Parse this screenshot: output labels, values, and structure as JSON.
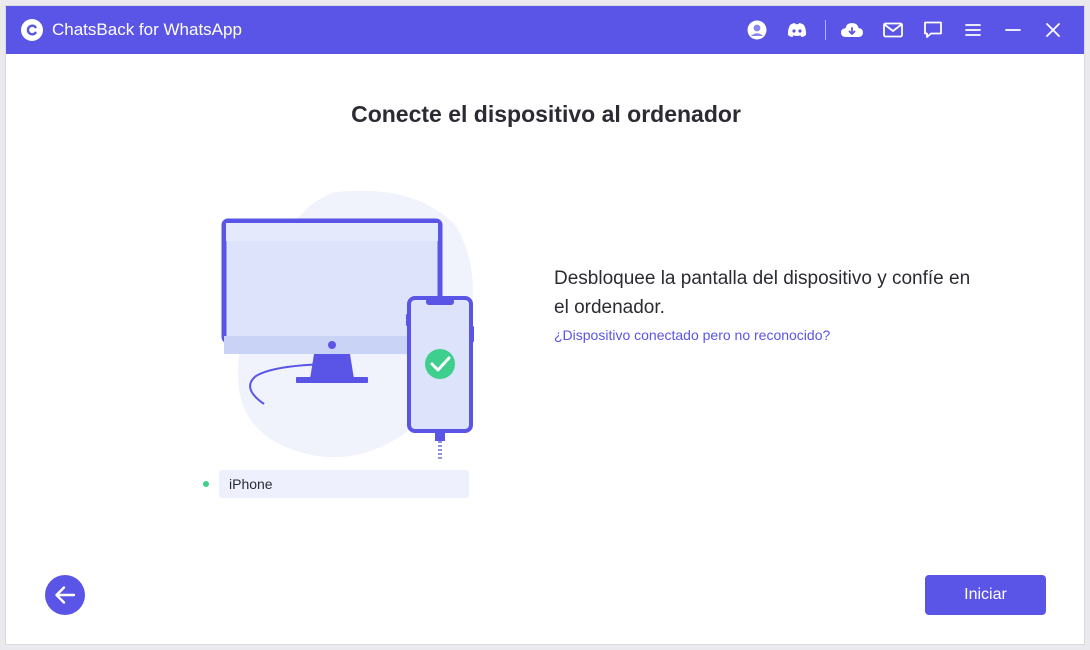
{
  "window": {
    "title": "ChatsBack for WhatsApp",
    "icons": [
      "account-icon",
      "discord-icon",
      "cloud-icon",
      "mail-icon",
      "feedback-icon",
      "menu-icon",
      "minimize-icon",
      "close-icon"
    ]
  },
  "main": {
    "title": "Conecte el dispositivo al ordenador",
    "device": {
      "name": "iPhone",
      "status_color": "#3ecf8e"
    },
    "instruction": "Desbloquee la pantalla del dispositivo y confíe en el ordenador.",
    "help_link": "¿Dispositivo conectado pero no reconocido?"
  },
  "footer": {
    "start_label": "Iniciar",
    "back_icon": "arrow-left-icon"
  },
  "colors": {
    "accent": "#5a55e6",
    "success": "#3ecf8e",
    "text": "#2b2b33"
  }
}
